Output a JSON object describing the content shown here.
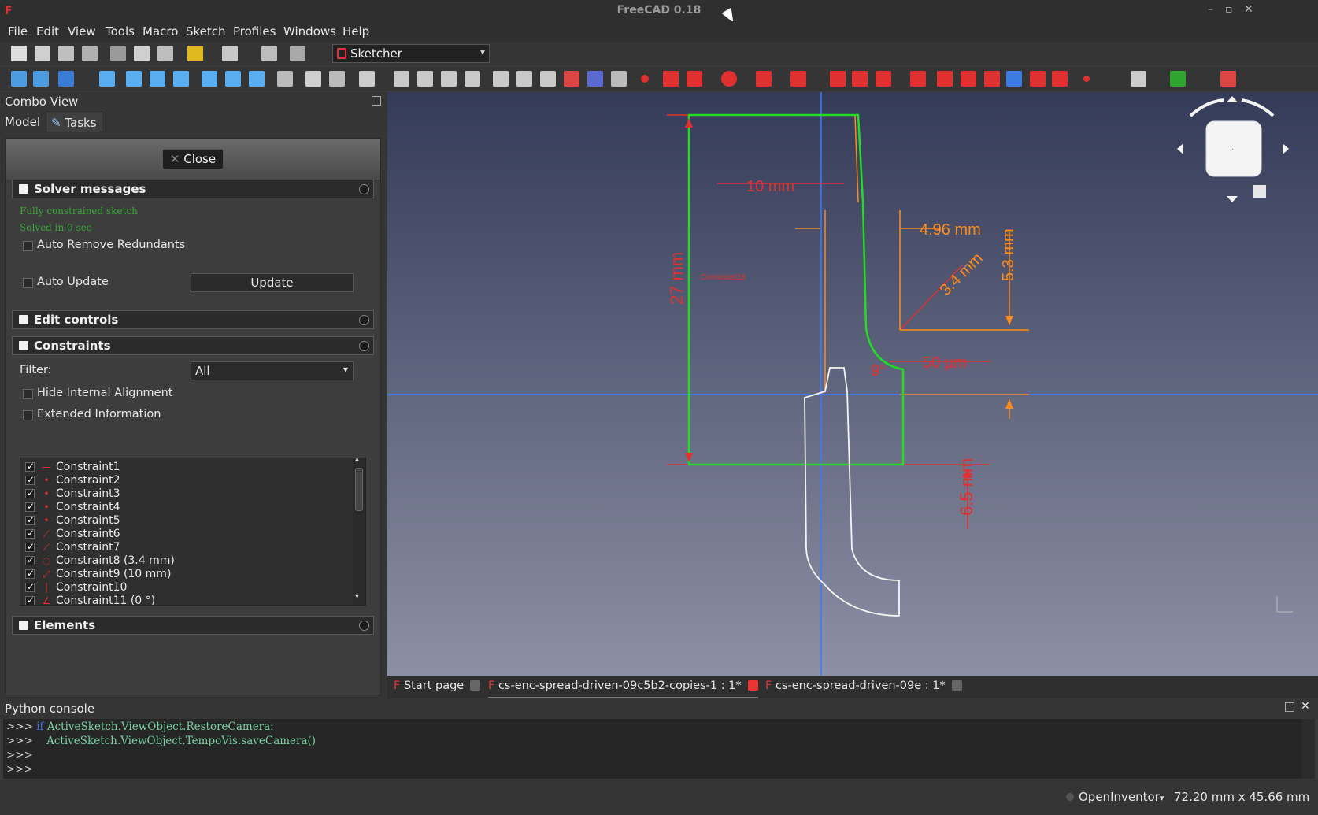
{
  "window": {
    "title": "FreeCAD 0.18",
    "controls": [
      "–",
      "▫",
      "✕"
    ]
  },
  "menu": [
    "File",
    "Edit",
    "View",
    "Tools",
    "Macro",
    "Sketch",
    "Profiles",
    "Windows",
    "Help"
  ],
  "workbench": {
    "selected": "Sketcher"
  },
  "combo_view": {
    "title": "Combo View",
    "tabs": [
      "Model",
      "Tasks"
    ],
    "active_tab": "Tasks",
    "close_label": "Close",
    "solver": {
      "title": "Solver messages",
      "msg1": "Fully constrained sketch",
      "msg2": "Solved in 0 sec",
      "auto_remove_redundants": "Auto Remove Redundants",
      "auto_update": "Auto Update",
      "update_label": "Update"
    },
    "edit_controls": {
      "title": "Edit controls"
    },
    "constraints": {
      "title": "Constraints",
      "filter_label": "Filter:",
      "filter_value": "All",
      "hide_internal_alignment": "Hide Internal Alignment",
      "extended_information": "Extended Information",
      "items": [
        {
          "label": "Constraint1",
          "icon": "horizontal-icon"
        },
        {
          "label": "Constraint2",
          "icon": "coincident-icon"
        },
        {
          "label": "Constraint3",
          "icon": "coincident-icon"
        },
        {
          "label": "Constraint4",
          "icon": "coincident-icon"
        },
        {
          "label": "Constraint5",
          "icon": "coincident-icon"
        },
        {
          "label": "Constraint6",
          "icon": "tangent-icon"
        },
        {
          "label": "Constraint7",
          "icon": "tangent-icon"
        },
        {
          "label": "Constraint8 (3.4 mm)",
          "icon": "radius-icon"
        },
        {
          "label": "Constraint9 (10 mm)",
          "icon": "distance-icon"
        },
        {
          "label": "Constraint10",
          "icon": "vertical-icon"
        },
        {
          "label": "Constraint11 (0 °)",
          "icon": "angle-icon"
        }
      ]
    },
    "elements": {
      "title": "Elements"
    }
  },
  "viewport": {
    "dimensions": [
      "10 mm",
      "4.96 mm",
      "3.4 mm",
      "5.3 mm",
      "27 mm",
      "50 µm",
      "6.5 mm",
      "9°"
    ],
    "small_label": "Constraint18",
    "nav_cube_face": "·"
  },
  "document_tabs": [
    {
      "label": "Start page",
      "active": false
    },
    {
      "label": "cs-enc-spread-driven-09c5b2-copies-1 : 1*",
      "active": true
    },
    {
      "label": "cs-enc-spread-driven-09e : 1*",
      "active": false
    }
  ],
  "python_console": {
    "title": "Python console",
    "lines": [
      {
        "prompt": ">>> ",
        "kw": "if ",
        "text": "ActiveSketch.ViewObject.RestoreCamera:"
      },
      {
        "prompt": ">>>    ",
        "kw": "",
        "text": "ActiveSketch.ViewObject.TempoVis.saveCamera()"
      },
      {
        "prompt": ">>> ",
        "kw": "",
        "text": ""
      },
      {
        "prompt": ">>> ",
        "kw": "",
        "text": ""
      }
    ]
  },
  "status": {
    "renderer": "OpenInventor",
    "dims": "72.20 mm x 45.66 mm"
  },
  "colors": {
    "accent_red": "#e03030",
    "sketch_green": "#22dd22",
    "dim_orange": "#ff8c1a",
    "axis_blue": "#3a7bff"
  }
}
